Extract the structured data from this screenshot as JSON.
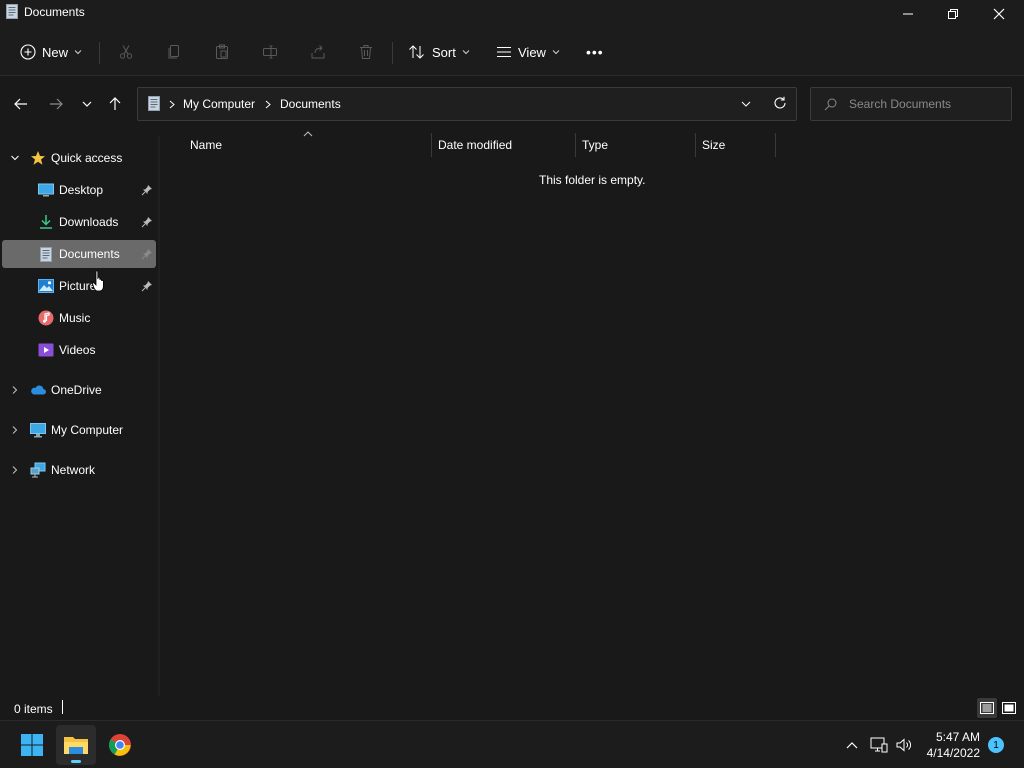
{
  "window": {
    "title": "Documents"
  },
  "commandbar": {
    "new_label": "New",
    "sort_label": "Sort",
    "view_label": "View",
    "more_label": "•••"
  },
  "address": {
    "crumbs": [
      "My Computer",
      "Documents"
    ]
  },
  "search": {
    "placeholder": "Search Documents"
  },
  "sidebar": {
    "quick_access_label": "Quick access",
    "items": [
      {
        "label": "Desktop",
        "icon": "desktop-icon",
        "pinned": true
      },
      {
        "label": "Downloads",
        "icon": "downloads-icon",
        "pinned": true
      },
      {
        "label": "Documents",
        "icon": "documents-icon",
        "pinned": true,
        "selected": true
      },
      {
        "label": "Pictures",
        "icon": "pictures-icon",
        "pinned": true
      },
      {
        "label": "Music",
        "icon": "music-icon",
        "pinned": false
      },
      {
        "label": "Videos",
        "icon": "videos-icon",
        "pinned": false
      }
    ],
    "roots": [
      {
        "label": "OneDrive",
        "icon": "onedrive-icon"
      },
      {
        "label": "My Computer",
        "icon": "computer-icon"
      },
      {
        "label": "Network",
        "icon": "network-icon"
      }
    ]
  },
  "content": {
    "columns": [
      "Name",
      "Date modified",
      "Type",
      "Size"
    ],
    "empty_message": "This folder is empty."
  },
  "status": {
    "item_count": "0 items"
  },
  "taskbar": {
    "time": "5:47 AM",
    "date": "4/14/2022",
    "notification_count": "1"
  },
  "colors": {
    "background": "#191919",
    "selected": "#6a6a6a",
    "accent": "#60cdff"
  }
}
